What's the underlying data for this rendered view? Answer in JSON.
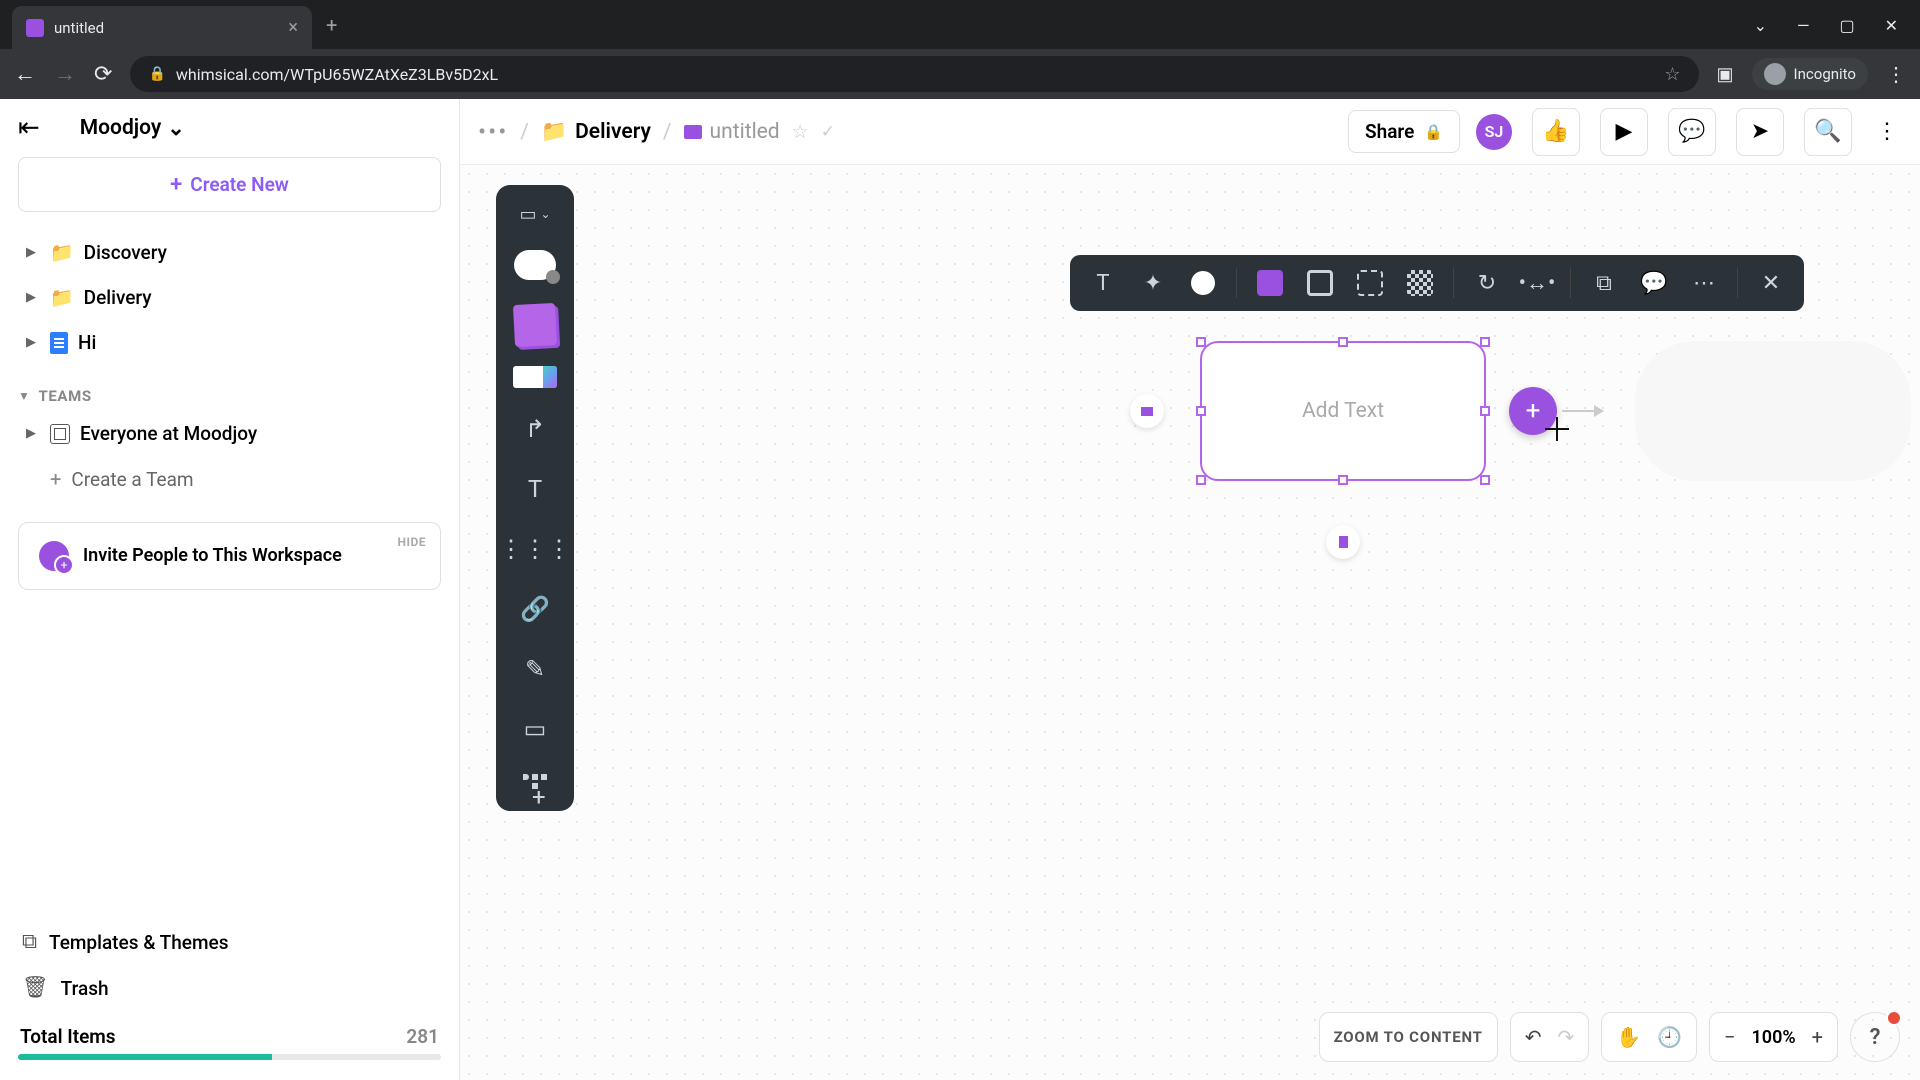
{
  "browser": {
    "tab_title": "untitled",
    "url": "whimsical.com/WTpU65WZAtXeZ3LBv5D2xL",
    "incognito_label": "Incognito"
  },
  "sidebar": {
    "workspace": "Moodjoy",
    "create_new": "Create New",
    "items": [
      {
        "label": "Discovery",
        "type": "folder"
      },
      {
        "label": "Delivery",
        "type": "folder"
      },
      {
        "label": "Hi",
        "type": "doc"
      }
    ],
    "teams_label": "TEAMS",
    "team_everyone": "Everyone at Moodjoy",
    "create_team": "Create a Team",
    "invite": {
      "hide": "HIDE",
      "text": "Invite People to This Workspace"
    },
    "templates": "Templates & Themes",
    "trash": "Trash",
    "total_items_label": "Total Items",
    "total_items_count": "281"
  },
  "topbar": {
    "folder": "Delivery",
    "doc_title": "untitled",
    "share": "Share",
    "avatar": "SJ"
  },
  "canvas": {
    "shape_placeholder": "Add Text"
  },
  "bottombar": {
    "zoom_to_content": "ZOOM TO CONTENT",
    "zoom_level": "100%",
    "help": "?"
  }
}
